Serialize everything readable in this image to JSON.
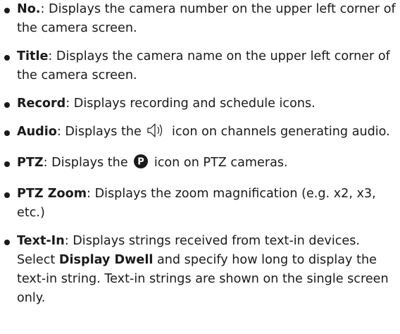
{
  "items": [
    {
      "term": "No.",
      "text": ": Displays the camera number on the upper left corner of the camera screen."
    },
    {
      "term": "Title",
      "text": ": Displays the camera name on the upper left corner of the camera screen."
    },
    {
      "term": "Record",
      "text": ": Displays recording and schedule icons."
    },
    {
      "term": "Audio",
      "text_before": ": Displays the ",
      "icon": "speaker-icon",
      "text_after": " icon on channels generating audio."
    },
    {
      "term": "PTZ",
      "text_before": ": Displays the ",
      "icon": "ptz-icon",
      "icon_letter": "P",
      "text_after": " icon on PTZ cameras."
    },
    {
      "term": "PTZ Zoom",
      "text": ": Displays the zoom magnification (e.g. x2, x3, etc.)"
    },
    {
      "term": "Text-In",
      "text_1": ": Displays strings received from text-in devices. Select ",
      "emph": "Display Dwell",
      "text_2": " and specify how long to display the text-in string. Text-in strings are shown on the single screen only."
    }
  ]
}
